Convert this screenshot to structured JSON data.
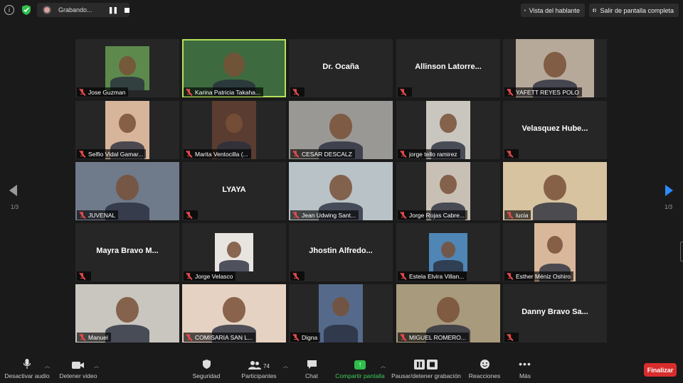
{
  "recording": {
    "label": "Grabando..."
  },
  "top_buttons": {
    "speaker_view": "Vista del hablante",
    "exit_fullscreen": "Salir de pantalla completa"
  },
  "pagination": {
    "left": "1/3",
    "right": "1/3"
  },
  "participants": [
    {
      "name": "Jose Guzman",
      "video": true
    },
    {
      "name": "Karina Patricia Takaha...",
      "video": true,
      "active": true
    },
    {
      "name": "Dr. Ocaña",
      "video": false
    },
    {
      "name": "Allinson  Latorre...",
      "video": false
    },
    {
      "name": "YAFETT REYES POLO",
      "video": true
    },
    {
      "name": "Selfio Vidal Gamar...",
      "video": true
    },
    {
      "name": "Marita Ventocilla (...",
      "video": true
    },
    {
      "name": "CESAR DESCALZ",
      "video": true
    },
    {
      "name": "jorge tello ramirez",
      "video": true
    },
    {
      "name": "Velasquez  Hube...",
      "video": false
    },
    {
      "name": "JUVENAL",
      "video": true
    },
    {
      "name": "LYAYA",
      "video": false
    },
    {
      "name": "Jean Udwing Sant...",
      "video": true
    },
    {
      "name": "Jorge Rojas Cabre...",
      "video": true
    },
    {
      "name": "lucia",
      "video": true
    },
    {
      "name": "Mayra  Bravo  M...",
      "video": false
    },
    {
      "name": "Jorge Velasco",
      "video": true
    },
    {
      "name": "Jhostin  Alfredo...",
      "video": false
    },
    {
      "name": "Estela Elvira Villan...",
      "video": true
    },
    {
      "name": "Esther Méniz Oshiro",
      "video": true
    },
    {
      "name": "Manuel",
      "video": true
    },
    {
      "name": "COMISARIA SAN L...",
      "video": true
    },
    {
      "name": "Digna",
      "video": true
    },
    {
      "name": "MIGUEL ROMERO...",
      "video": true
    },
    {
      "name": "Danny  Bravo  Sa...",
      "video": false
    }
  ],
  "toolbar": {
    "mute": "Desactivar audio",
    "video": "Detener video",
    "security": "Seguridad",
    "participants": "Participantes",
    "participants_count": "74",
    "chat": "Chat",
    "share": "Compartir pantalla",
    "record": "Pausar/detener grabación",
    "reactions": "Reacciones",
    "more": "Más",
    "end": "Finalizar"
  },
  "colors": {
    "background": "#1a1a1a",
    "tile": "#262626",
    "active_border": "#b7e15a",
    "share_green": "#2fbe4c",
    "end_red": "#d82d2d",
    "nav_blue": "#2b8bff"
  }
}
